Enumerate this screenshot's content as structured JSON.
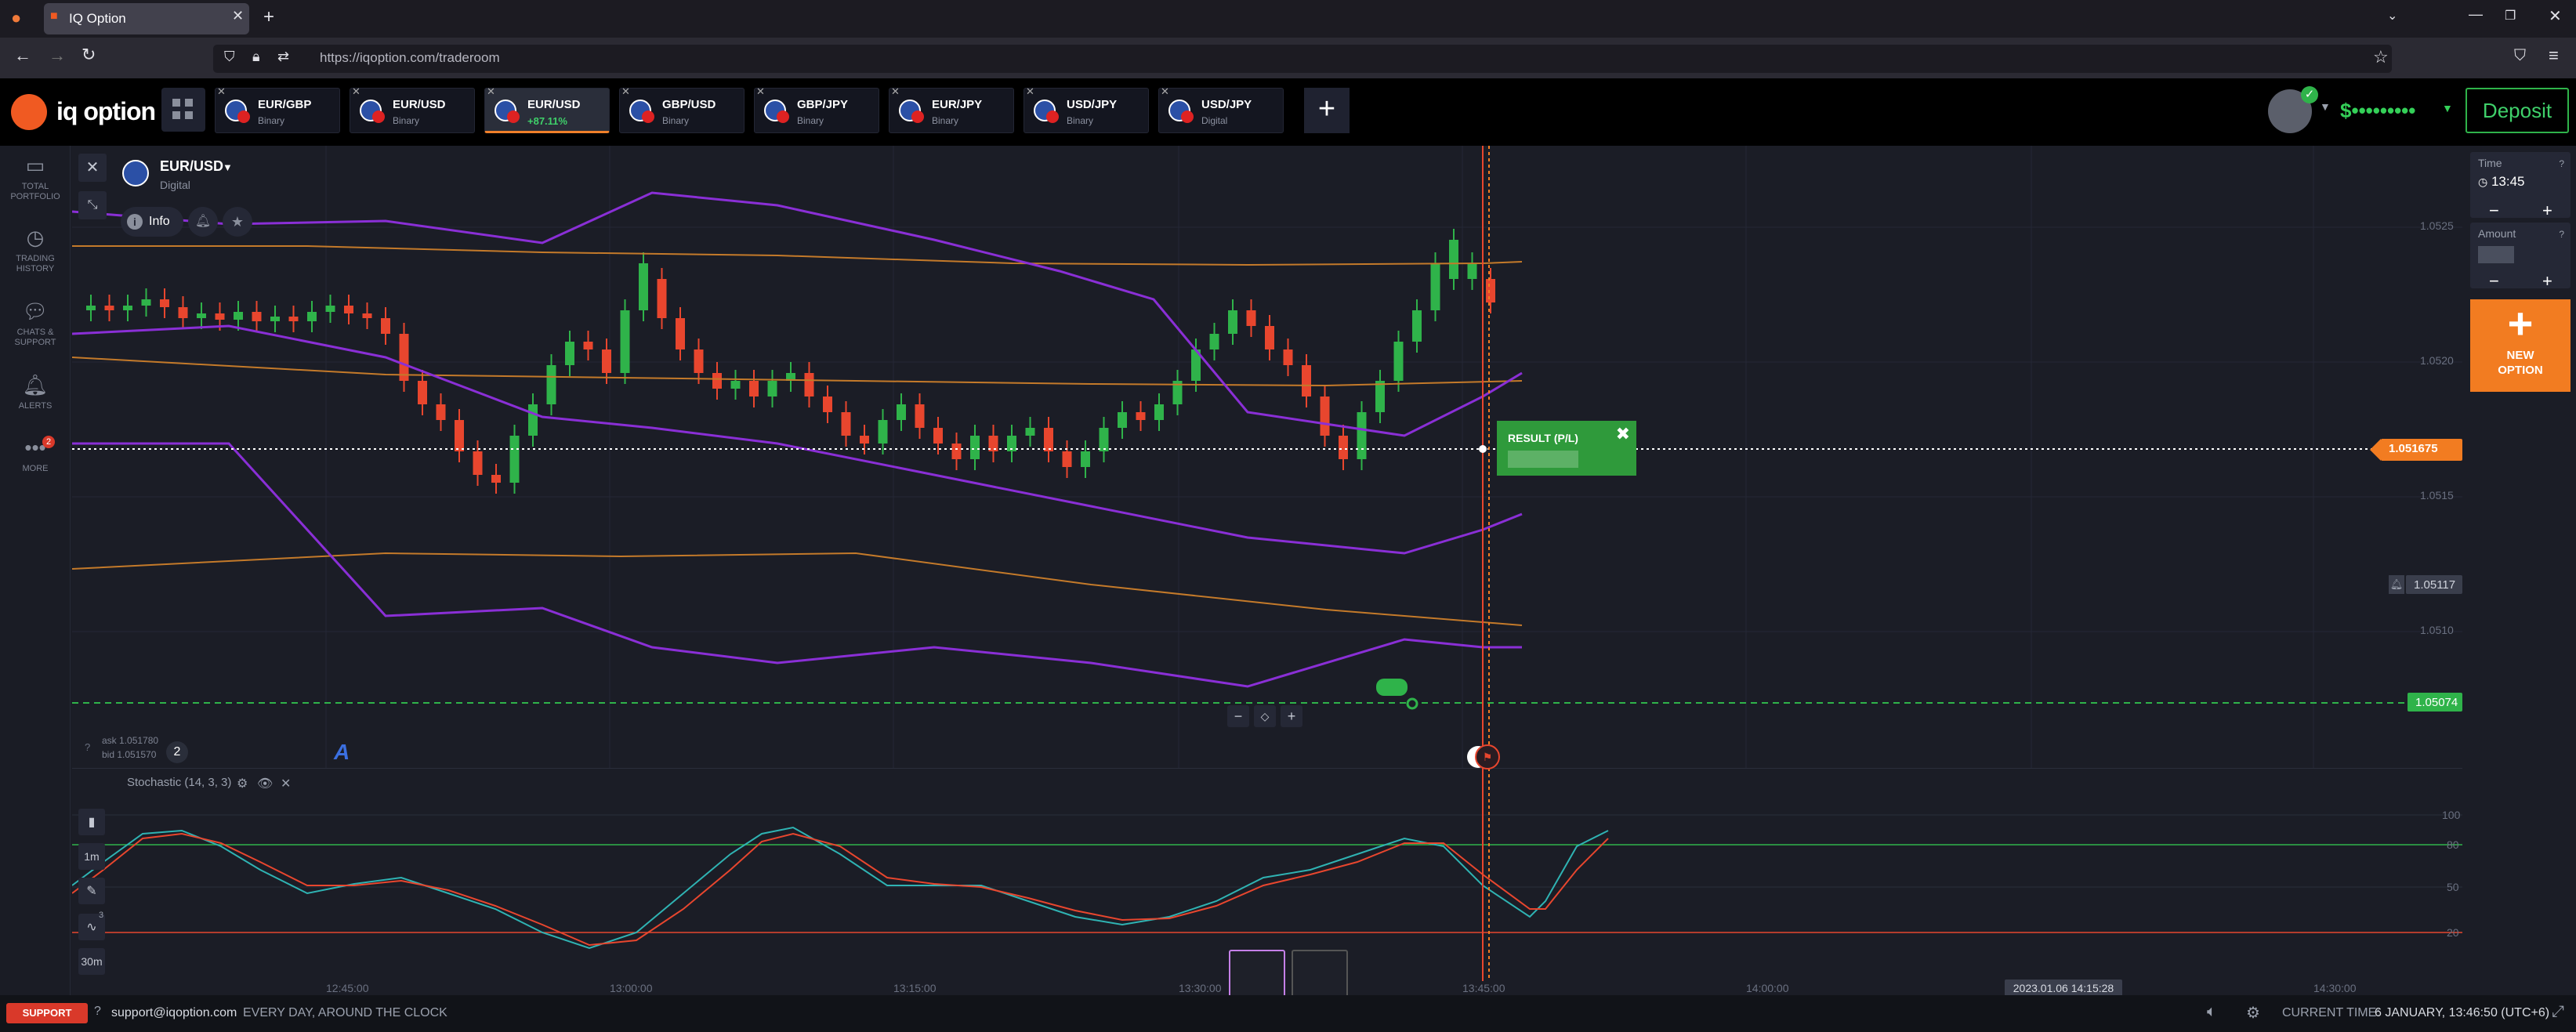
{
  "browser": {
    "tab_title": "IQ Option",
    "url": "https://iqoption.com/traderoom"
  },
  "header": {
    "logo_text": "iq option",
    "assets": [
      {
        "name": "EUR/GBP",
        "type": "Binary",
        "active": false
      },
      {
        "name": "EUR/USD",
        "type": "Binary",
        "active": false
      },
      {
        "name": "EUR/USD",
        "type": "+87.11%",
        "active": true
      },
      {
        "name": "GBP/USD",
        "type": "Binary",
        "active": false
      },
      {
        "name": "GBP/JPY",
        "type": "Binary",
        "active": false
      },
      {
        "name": "EUR/JPY",
        "type": "Binary",
        "active": false
      },
      {
        "name": "USD/JPY",
        "type": "Binary",
        "active": false
      },
      {
        "name": "USD/JPY",
        "type": "Digital",
        "active": false
      }
    ],
    "add_label": "+",
    "balance": "$•••••••••",
    "deposit_label": "Deposit"
  },
  "sidebar": {
    "items": [
      {
        "line1": "TOTAL",
        "line2": "PORTFOLIO",
        "icon": "briefcase-icon"
      },
      {
        "line1": "TRADING",
        "line2": "HISTORY",
        "icon": "history-icon"
      },
      {
        "line1": "CHATS &",
        "line2": "SUPPORT",
        "icon": "chat-icon"
      },
      {
        "line1": "ALERTS",
        "line2": "",
        "icon": "bell-icon"
      },
      {
        "line1": "MORE",
        "line2": "",
        "icon": "more-icon"
      }
    ],
    "more_badge": "2"
  },
  "chart": {
    "asset_name": "EUR/USD",
    "asset_type": "Digital",
    "info_label": "Info",
    "price_levels": [
      "1.0525",
      "1.0520",
      "1.0515",
      "1.0510"
    ],
    "current_price": "1.051675",
    "alert_price": "1.05117",
    "strike_price": "1.05074",
    "ask": "ask 1.051780",
    "bid": "bid 1.051570",
    "count_badge": "2",
    "result_label": "RESULT (P/L)",
    "zoom_minus": "−",
    "zoom_plus": "+",
    "colors": {
      "up": "#2fb34a",
      "down": "#e8462e",
      "bollinger": "#8a2fd6",
      "ma": "#c47a2a",
      "current": "#f27c21"
    }
  },
  "stochastic": {
    "label": "Stochastic (14, 3, 3)",
    "levels": [
      "100",
      "80",
      "50",
      "20"
    ],
    "time_labels": [
      "12:45:00",
      "13:00:00",
      "13:15:00",
      "13:30:00",
      "13:45:00",
      "14:00:00",
      "14:30:00"
    ],
    "cursor_time": "2023.01.06 14:15:28",
    "period_1": "1m",
    "period_2": "30m",
    "tool_badge": "3"
  },
  "right_panel": {
    "time_label": "Time",
    "time_value": "13:45",
    "amount_label": "Amount",
    "new_option_line1": "NEW",
    "new_option_line2": "OPTION"
  },
  "footer": {
    "support_label": "SUPPORT",
    "email": "support@iqoption.com",
    "hours": "EVERY DAY, AROUND THE CLOCK",
    "current_time_label": "CURRENT TIME:",
    "current_time_value": "6 JANUARY, 13:46:50 (UTC+6)"
  }
}
